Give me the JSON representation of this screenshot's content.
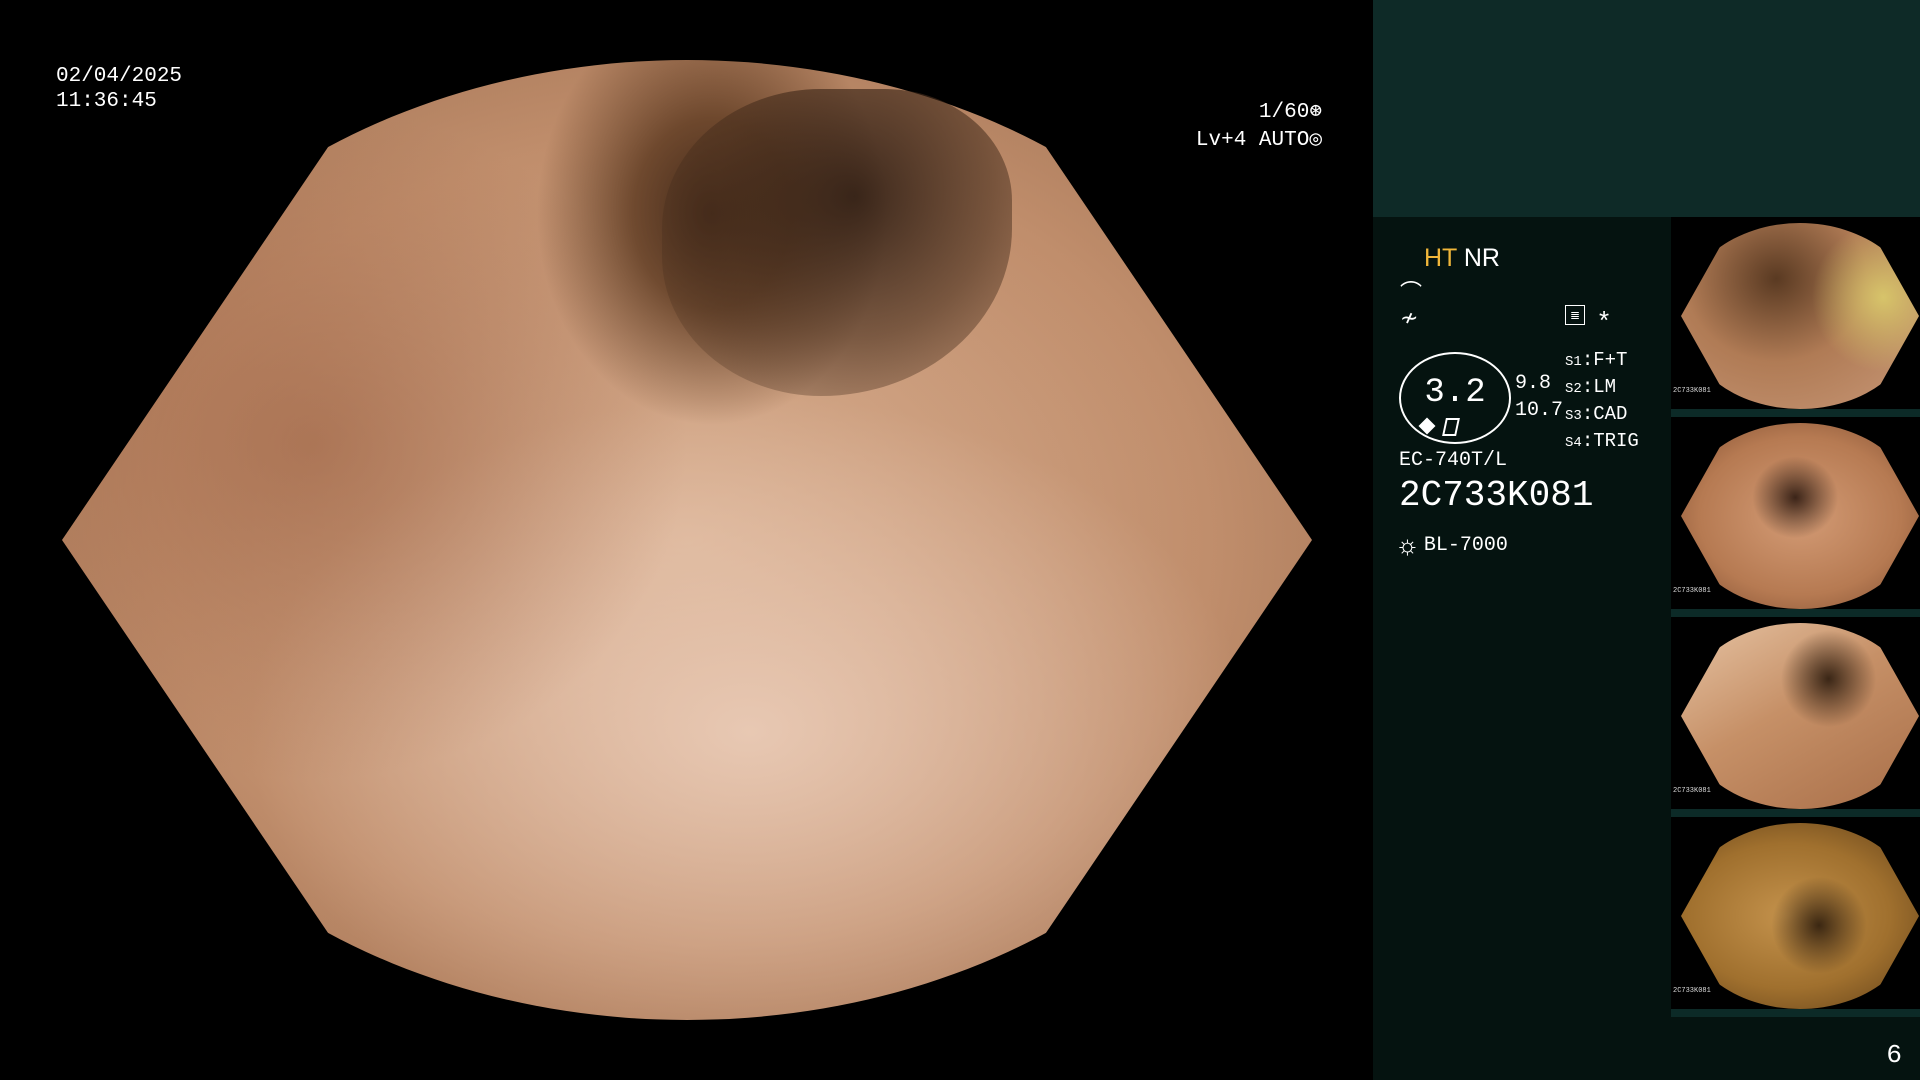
{
  "main": {
    "date": "02/04/2025",
    "time": "11:36:45",
    "shutter": "1/60",
    "level": "Lv+4",
    "iris_mode": "AUTO"
  },
  "panel": {
    "ht": "HT",
    "nr": "NR",
    "icon_1": "enhancement-curve-icon",
    "icon_2": "filter-off-icon",
    "icon_3": "menu-list-icon",
    "star": "*",
    "zoom": "3.2",
    "zoom_min": "9.8",
    "zoom_max": "10.7",
    "modes": [
      {
        "key": "S1",
        "value": "F+T"
      },
      {
        "key": "S2",
        "value": "LM"
      },
      {
        "key": "S3",
        "value": "CAD"
      },
      {
        "key": "S4",
        "value": "TRIG"
      }
    ],
    "scope_model": "EC-740T/L",
    "scope_serial": "2C733K081",
    "light_source": "BL-7000",
    "thumbnail_serial": "2C733K081",
    "page_number": "6"
  },
  "colors": {
    "panel_bg": "#051310",
    "panel_top": "#0e2a27",
    "ht_accent": "#f0b63a"
  }
}
